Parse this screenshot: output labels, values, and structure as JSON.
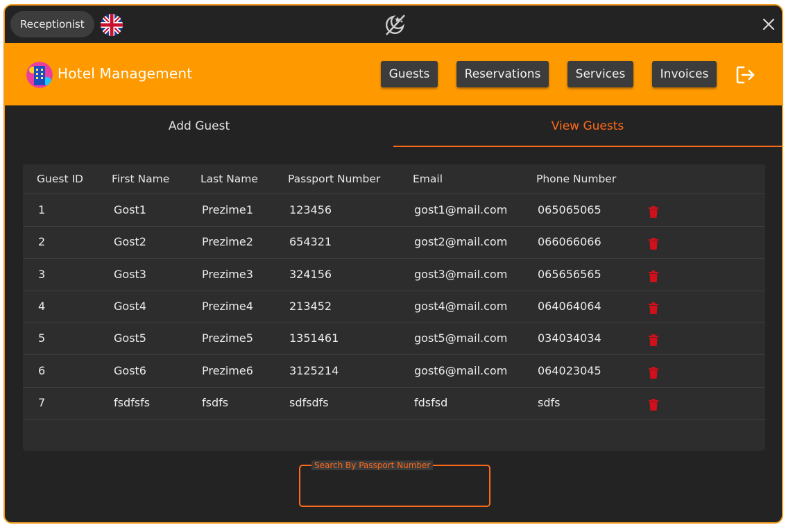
{
  "titlebar": {
    "role": "Receptionist",
    "language_icon": "uk-flag-icon",
    "theme_icon": "theme-toggle-icon",
    "close_icon": "close-icon"
  },
  "header": {
    "app_title": "Hotel Management",
    "nav": [
      "Guests",
      "Reservations",
      "Services",
      "Invoices"
    ],
    "logout_icon": "logout-icon"
  },
  "tabs": {
    "add": "Add Guest",
    "view": "View Guests",
    "active": "View Guests"
  },
  "table": {
    "headers": [
      "Guest ID",
      "First Name",
      "Last Name",
      "Passport Number",
      "Email",
      "Phone Number"
    ],
    "rows": [
      [
        "1",
        "Gost1",
        "Prezime1",
        "123456",
        "gost1@mail.com",
        "065065065"
      ],
      [
        "2",
        "Gost2",
        "Prezime2",
        "654321",
        "gost2@mail.com",
        "066066066"
      ],
      [
        "3",
        "Gost3",
        "Prezime3",
        "324156",
        "gost3@mail.com",
        "065656565"
      ],
      [
        "4",
        "Gost4",
        "Prezime4",
        "213452",
        "gost4@mail.com",
        "064064064"
      ],
      [
        "5",
        "Gost5",
        "Prezime5",
        "1351461",
        "gost5@mail.com",
        "034034034"
      ],
      [
        "6",
        "Gost6",
        "Prezime6",
        "3125214",
        "gost6@mail.com",
        "064023045"
      ],
      [
        "7",
        "fsdfsfs",
        "fsdfs",
        "sdfsdfs",
        "fdsfsd",
        "sdfs"
      ]
    ],
    "row_action_icon": "trash-icon"
  },
  "search": {
    "label": "Search By Passport Number",
    "value": ""
  },
  "colors": {
    "accent": "#ff6a1a",
    "header_bg": "#fe9a00",
    "window_border": "#f29a1e",
    "delete": "#d0101a"
  }
}
